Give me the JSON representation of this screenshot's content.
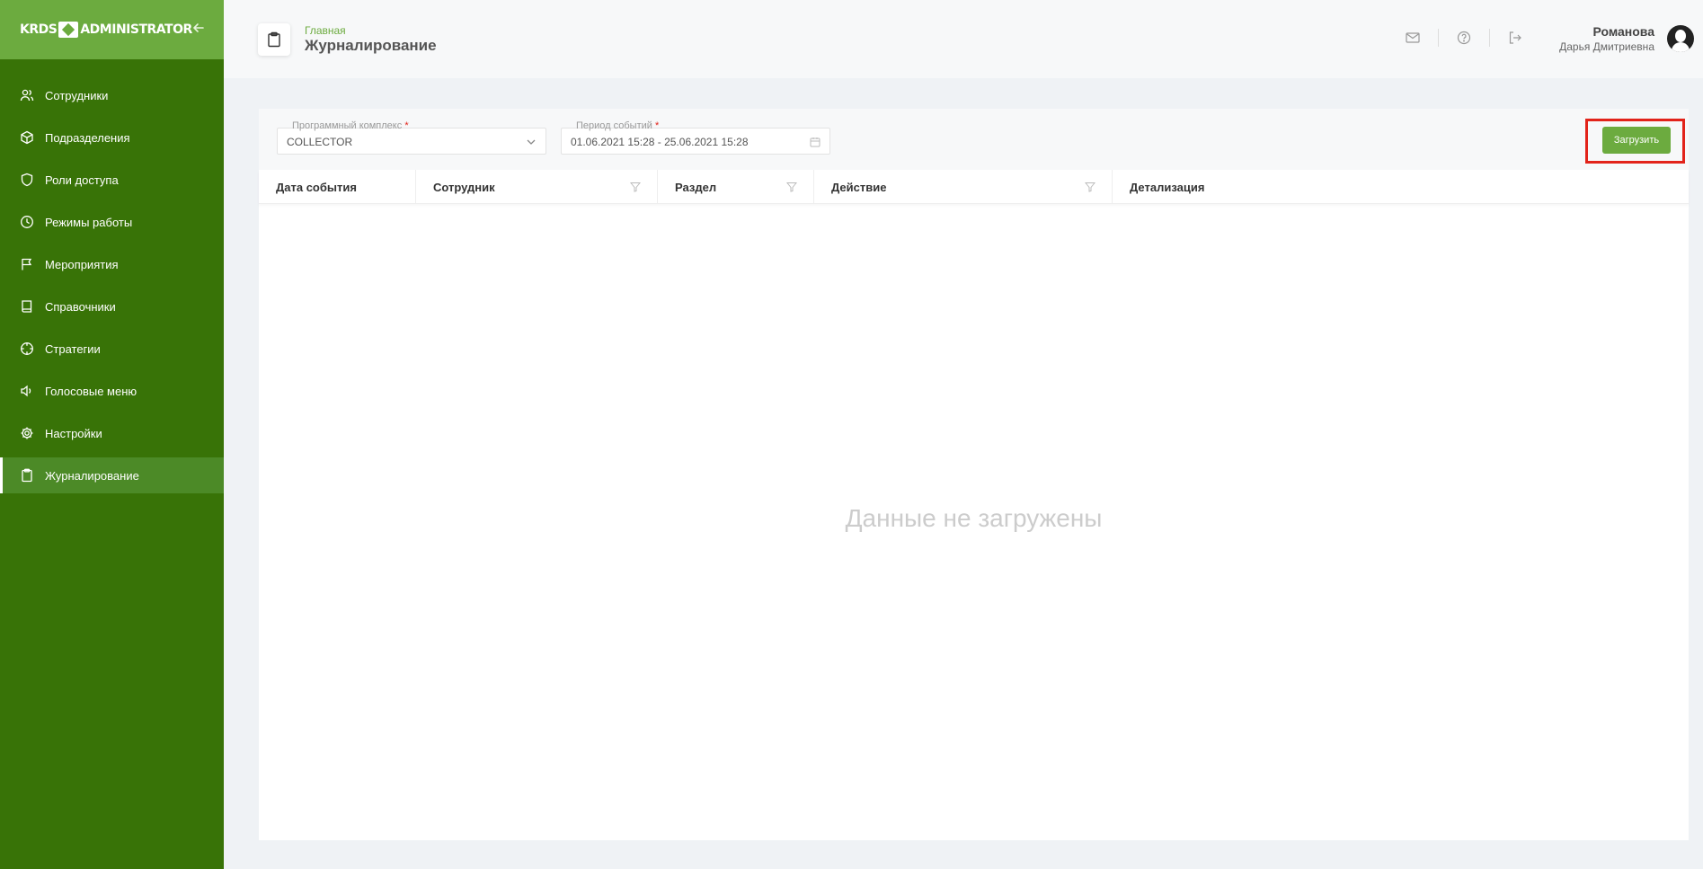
{
  "brand": {
    "left": "KRDS",
    "right": "ADMINISTRATOR"
  },
  "sidebar": {
    "items": [
      {
        "label": "Сотрудники",
        "icon": "users-icon"
      },
      {
        "label": "Подразделения",
        "icon": "cube-icon"
      },
      {
        "label": "Роли доступа",
        "icon": "shield-icon"
      },
      {
        "label": "Режимы работы",
        "icon": "clock-icon"
      },
      {
        "label": "Мероприятия",
        "icon": "flag-icon"
      },
      {
        "label": "Справочники",
        "icon": "book-icon"
      },
      {
        "label": "Стратегии",
        "icon": "crosshair-icon"
      },
      {
        "label": "Голосовые меню",
        "icon": "speaker-icon"
      },
      {
        "label": "Настройки",
        "icon": "gear-icon"
      },
      {
        "label": "Журналирование",
        "icon": "clipboard-icon",
        "active": true
      }
    ]
  },
  "header": {
    "breadcrumb": "Главная",
    "title": "Журналирование",
    "user_last": "Романова",
    "user_first": "Дарья Дмитриевна"
  },
  "filters": {
    "complex_label": "Программный комплекс",
    "complex_value": "COLLECTOR",
    "period_label": "Период событий",
    "period_value": "01.06.2021 15:28 - 25.06.2021 15:28",
    "required_mark": "*",
    "load_label": "Загрузить"
  },
  "table": {
    "columns": [
      {
        "label": "Дата события",
        "filter": false
      },
      {
        "label": "Сотрудник",
        "filter": true
      },
      {
        "label": "Раздел",
        "filter": true
      },
      {
        "label": "Действие",
        "filter": true
      },
      {
        "label": "Детализация",
        "filter": false
      }
    ],
    "empty_text": "Данные не загружены"
  },
  "colors": {
    "sidebar": "#387307",
    "accent": "#6cab3f",
    "highlight": "#e2231a"
  }
}
